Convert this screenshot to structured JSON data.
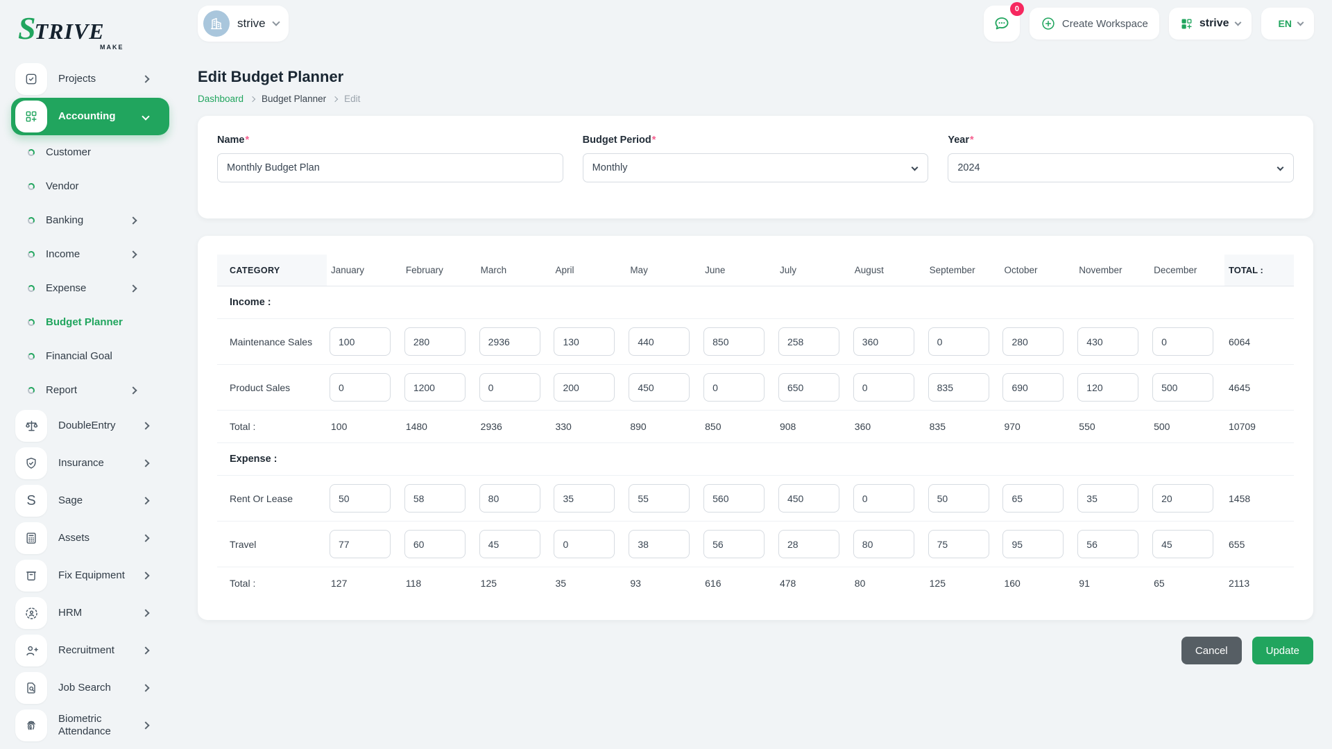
{
  "brand": {
    "logo_part1": "S",
    "logo_part2": "TRIVE",
    "tagline": "MAKE"
  },
  "topbar": {
    "workspace_name": "strive",
    "chat_badge": "0",
    "create_workspace_label": "Create Workspace",
    "company_name": "strive",
    "language": "EN"
  },
  "sidebar": {
    "items": [
      {
        "label": "Projects",
        "icon": "checkbox-icon",
        "type": "main",
        "chevron": "right",
        "active": false
      },
      {
        "label": "Accounting",
        "icon": "grid-plus-icon",
        "type": "main",
        "chevron": "down",
        "active": true
      },
      {
        "label": "Customer",
        "type": "sub",
        "chevron": null,
        "active": false
      },
      {
        "label": "Vendor",
        "type": "sub",
        "chevron": null,
        "active": false
      },
      {
        "label": "Banking",
        "type": "sub",
        "chevron": "right",
        "active": false
      },
      {
        "label": "Income",
        "type": "sub",
        "chevron": "right",
        "active": false
      },
      {
        "label": "Expense",
        "type": "sub",
        "chevron": "right",
        "active": false
      },
      {
        "label": "Budget Planner",
        "type": "sub",
        "chevron": null,
        "active": true
      },
      {
        "label": "Financial Goal",
        "type": "sub",
        "chevron": null,
        "active": false
      },
      {
        "label": "Report",
        "type": "sub",
        "chevron": "right",
        "active": false
      },
      {
        "label": "DoubleEntry",
        "icon": "scale-icon",
        "type": "main",
        "chevron": "right",
        "active": false
      },
      {
        "label": "Insurance",
        "icon": "shield-check-icon",
        "type": "main",
        "chevron": "right",
        "active": false
      },
      {
        "label": "Sage",
        "icon": "letter-s-icon",
        "type": "main",
        "chevron": "right",
        "active": false
      },
      {
        "label": "Assets",
        "icon": "calculator-icon",
        "type": "main",
        "chevron": "right",
        "active": false
      },
      {
        "label": "Fix Equipment",
        "icon": "archive-box-icon",
        "type": "main",
        "chevron": "right",
        "active": false
      },
      {
        "label": "HRM",
        "icon": "person-target-icon",
        "type": "main",
        "chevron": "right",
        "active": false
      },
      {
        "label": "Recruitment",
        "icon": "person-plus-icon",
        "type": "main",
        "chevron": "right",
        "active": false
      },
      {
        "label": "Job Search",
        "icon": "document-search-icon",
        "type": "main",
        "chevron": "right",
        "active": false
      },
      {
        "label": "Biometric Attendance",
        "icon": "fingerprint-icon",
        "type": "main",
        "chevron": "right",
        "active": false
      }
    ]
  },
  "page": {
    "title": "Edit Budget Planner",
    "breadcrumb": [
      "Dashboard",
      "Budget Planner",
      "Edit"
    ]
  },
  "form": {
    "required_mark": "*",
    "name_label": "Name",
    "name_value": "Monthly Budget Plan",
    "period_label": "Budget Period",
    "period_value": "Monthly",
    "year_label": "Year",
    "year_value": "2024"
  },
  "table": {
    "category_header": "CATEGORY",
    "total_header": "TOTAL :",
    "months": [
      "January",
      "February",
      "March",
      "April",
      "May",
      "June",
      "July",
      "August",
      "September",
      "October",
      "November",
      "December"
    ],
    "sections": [
      {
        "name": "Income :",
        "rows": [
          {
            "label": "Maintenance Sales",
            "values": [
              100,
              280,
              2936,
              130,
              440,
              850,
              258,
              360,
              0,
              280,
              430,
              0
            ],
            "total": 6064
          },
          {
            "label": "Product Sales",
            "values": [
              0,
              1200,
              0,
              200,
              450,
              0,
              650,
              0,
              835,
              690,
              120,
              500
            ],
            "total": 4645
          }
        ],
        "total_label": "Total :",
        "totals": [
          100,
          1480,
          2936,
          330,
          890,
          850,
          908,
          360,
          835,
          970,
          550,
          500
        ],
        "grand_total": 10709
      },
      {
        "name": "Expense :",
        "rows": [
          {
            "label": "Rent Or Lease",
            "values": [
              50,
              58,
              80,
              35,
              55,
              560,
              450,
              0,
              50,
              65,
              35,
              20
            ],
            "total": 1458
          },
          {
            "label": "Travel",
            "values": [
              77,
              60,
              45,
              0,
              38,
              56,
              28,
              80,
              75,
              95,
              56,
              45
            ],
            "total": 655
          }
        ],
        "total_label": "Total :",
        "totals": [
          127,
          118,
          125,
          35,
          93,
          616,
          478,
          80,
          125,
          160,
          91,
          65
        ],
        "grand_total": 2113
      }
    ]
  },
  "actions": {
    "cancel_label": "Cancel",
    "update_label": "Update"
  },
  "colors": {
    "accent_green": "#21a55e",
    "badge_red": "#f6285f",
    "required_pink": "#f55f8e",
    "cancel_gray": "#565e64"
  }
}
